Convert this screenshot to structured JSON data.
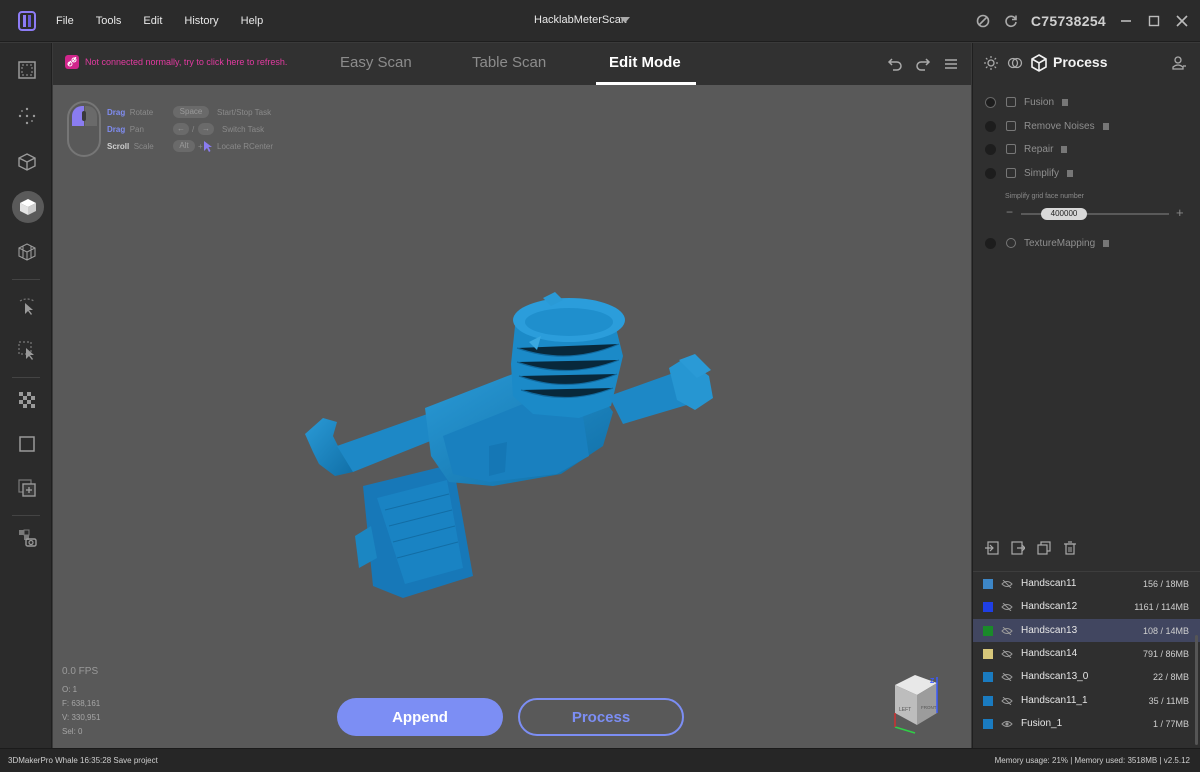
{
  "titlebar": {
    "menu": [
      "File",
      "Tools",
      "Edit",
      "History",
      "Help"
    ],
    "project_name": "HacklabMeterScan",
    "device_id": "C75738254"
  },
  "leftbar": {
    "icons": [
      "frame-icon",
      "point-cloud-icon",
      "wireframe-cube-icon",
      "solid-cube-icon",
      "mesh-cube-icon",
      "select-arrow-icon",
      "box-select-icon",
      "checker-icon",
      "crop-icon",
      "add-layer-icon",
      "snapshot-icon"
    ]
  },
  "viewport": {
    "connection_warning": "Not connected normally, try to click here to refresh.",
    "tabs": [
      "Easy Scan",
      "Table Scan",
      "Edit Mode"
    ],
    "active_tab": "Edit Mode",
    "hints": {
      "drag1": "Drag",
      "rotate": "Rotate",
      "drag2": "Drag",
      "pan": "Pan",
      "scroll": "Scroll",
      "scale": "Scale",
      "space": "Space",
      "start_stop": "Start/Stop Task",
      "slash": "/",
      "switch_task": "Switch Task",
      "alt": "Alt",
      "plus": "+",
      "locate": "Locate RCenter"
    },
    "stats": {
      "fps": "0.0 FPS",
      "o": "O: 1",
      "f": "F: 638,161",
      "v": "V: 330,951",
      "sel": "Sel: 0"
    },
    "buttons": {
      "append": "Append",
      "process": "Process"
    },
    "navcube": {
      "left": "LEFT",
      "front": "FRONT",
      "z": "Z"
    }
  },
  "rightpanel": {
    "title": "Process",
    "steps": [
      {
        "label": "Fusion"
      },
      {
        "label": "Remove Noises"
      },
      {
        "label": "Repair"
      },
      {
        "label": "Simplify"
      },
      {
        "label": "TextureMapping"
      }
    ],
    "simplify": {
      "label": "Simplify grid face number",
      "value": "400000",
      "minus": "−",
      "plus": "+"
    },
    "layers": [
      {
        "name": "Handscan11",
        "size": "156 / 18MB",
        "color": "#3d86c6"
      },
      {
        "name": "Handscan12",
        "size": "1161 / 114MB",
        "color": "#1f3fe6"
      },
      {
        "name": "Handscan13",
        "size": "108 / 14MB",
        "color": "#1a8a2a"
      },
      {
        "name": "Handscan14",
        "size": "791 / 86MB",
        "color": "#d7c77a"
      },
      {
        "name": "Handscan13_0",
        "size": "22 / 8MB",
        "color": "#1a7bc0"
      },
      {
        "name": "Handscan11_1",
        "size": "35 / 11MB",
        "color": "#1a7bc0"
      },
      {
        "name": "Fusion_1",
        "size": "1 / 77MB",
        "color": "#1a7bc0"
      }
    ]
  },
  "statusbar": {
    "left": "3DMakerPro Whale   16:35:28 Save project",
    "right": "Memory usage: 21% | Memory used: 3518MB | v2.5.12"
  }
}
